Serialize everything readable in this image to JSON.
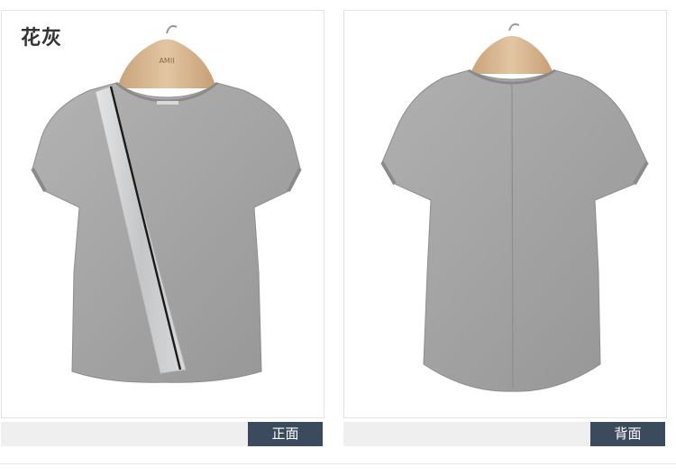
{
  "color_name": "花灰",
  "views": [
    {
      "caption": "正面"
    },
    {
      "caption": "背面"
    }
  ],
  "hanger_brand": "AMII",
  "colors": {
    "shirt": "#a6a6a6",
    "caption_tag_bg": "#3b4b5d",
    "caption_bar_bg": "#efefef",
    "silver_stripe": "#cfd0d2",
    "black_stripe": "#1a1a1a"
  }
}
